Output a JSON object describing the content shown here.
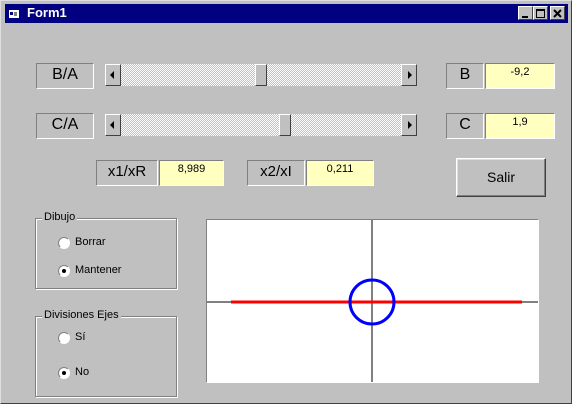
{
  "window": {
    "title": "Form1"
  },
  "params": {
    "ba": {
      "label": "B/A",
      "slider_fraction": 0.5
    },
    "ca": {
      "label": "C/A",
      "slider_fraction": 0.59
    },
    "b": {
      "label": "B",
      "value": "-9,2"
    },
    "c": {
      "label": "C",
      "value": "1,9"
    }
  },
  "roots": {
    "x1": {
      "label": "x1/xR",
      "value": "8,989"
    },
    "x2": {
      "label": "x2/xI",
      "value": "0,211"
    }
  },
  "exit_button": "Salir",
  "groups": {
    "dibujo": {
      "title": "Dibujo",
      "options": [
        "Borrar",
        "Mantener"
      ],
      "selected": 1
    },
    "divisiones": {
      "title": "Divisiones Ejes",
      "options": [
        "Sí",
        "No"
      ],
      "selected": 1
    }
  },
  "colors": {
    "title_bar": "#000080",
    "value_bg": "#ffffc0",
    "real_line": "#ff0000",
    "circle": "#0000ff"
  }
}
